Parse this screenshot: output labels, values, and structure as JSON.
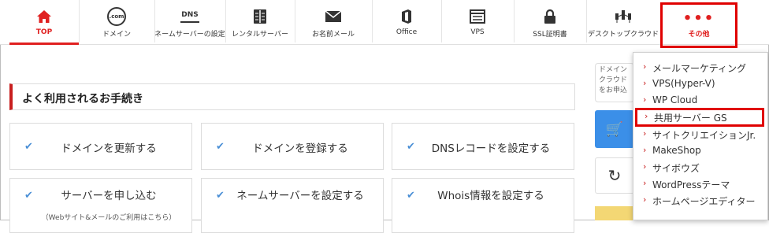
{
  "nav": {
    "items": [
      {
        "label": "TOP",
        "icon": "home-icon",
        "active": true
      },
      {
        "label": "ドメイン",
        "icon": "dotcom-icon"
      },
      {
        "label": "ネームサーバーの設定",
        "icon": "dns-icon"
      },
      {
        "label": "レンタルサーバー",
        "icon": "server-icon"
      },
      {
        "label": "お名前メール",
        "icon": "mail-icon"
      },
      {
        "label": "Office",
        "icon": "office-icon"
      },
      {
        "label": "VPS",
        "icon": "vps-icon"
      },
      {
        "label": "SSL証明書",
        "icon": "lock-icon"
      },
      {
        "label": "デスクトップクラウド",
        "icon": "cloud-icon"
      },
      {
        "label": "その他",
        "icon": "more-dots-icon"
      }
    ],
    "dotcom_glyph": ".com",
    "dns_glyph": "DNS",
    "more_glyph": "•••"
  },
  "section": {
    "title": "よく利用されるお手続き"
  },
  "cards": [
    {
      "label": "ドメインを更新する"
    },
    {
      "label": "ドメインを登録する"
    },
    {
      "label": "DNSレコードを設定する"
    },
    {
      "label": "サーバーを申し込む",
      "sub": "（Webサイト&メールのご利用はこちら）"
    },
    {
      "label": "ネームサーバーを設定する"
    },
    {
      "label": "Whois情報を設定する"
    }
  ],
  "right": {
    "info_lines": [
      "ドメイン",
      "クラウド",
      "をお申込"
    ]
  },
  "dropdown": {
    "items": [
      "メールマーケティング",
      "VPS(Hyper-V)",
      "WP Cloud",
      "共用サーバー GS",
      "サイトクリエイションJr.",
      "MakeShop",
      "サイボウズ",
      "WordPressテーマ",
      "ホームページエディター"
    ],
    "highlighted_index": 3
  },
  "colors": {
    "accent": "#e02020",
    "check": "#4a8fd6",
    "cart": "#3b8fe8",
    "highlight": "#e00000"
  }
}
